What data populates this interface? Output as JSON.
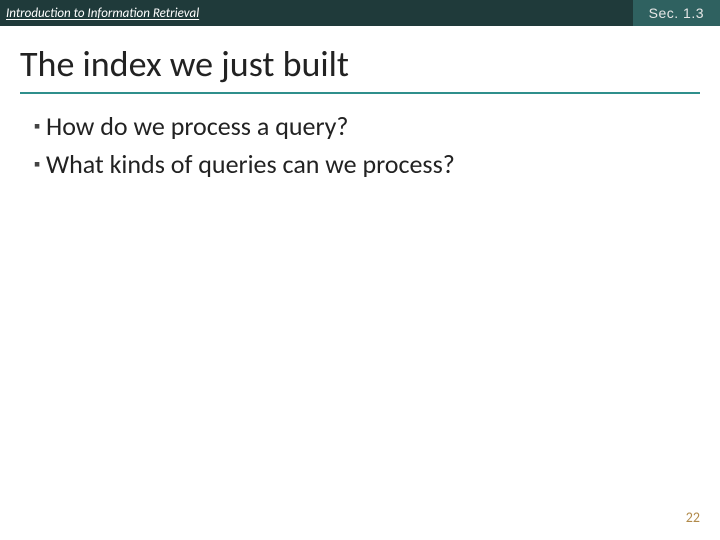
{
  "header": {
    "left": "Introduction to Information Retrieval",
    "right": "Sec. 1.3"
  },
  "title": "The index we just built",
  "bullets": [
    "How do we process a query?",
    "What kinds of queries can we process?"
  ],
  "page_number": "22"
}
